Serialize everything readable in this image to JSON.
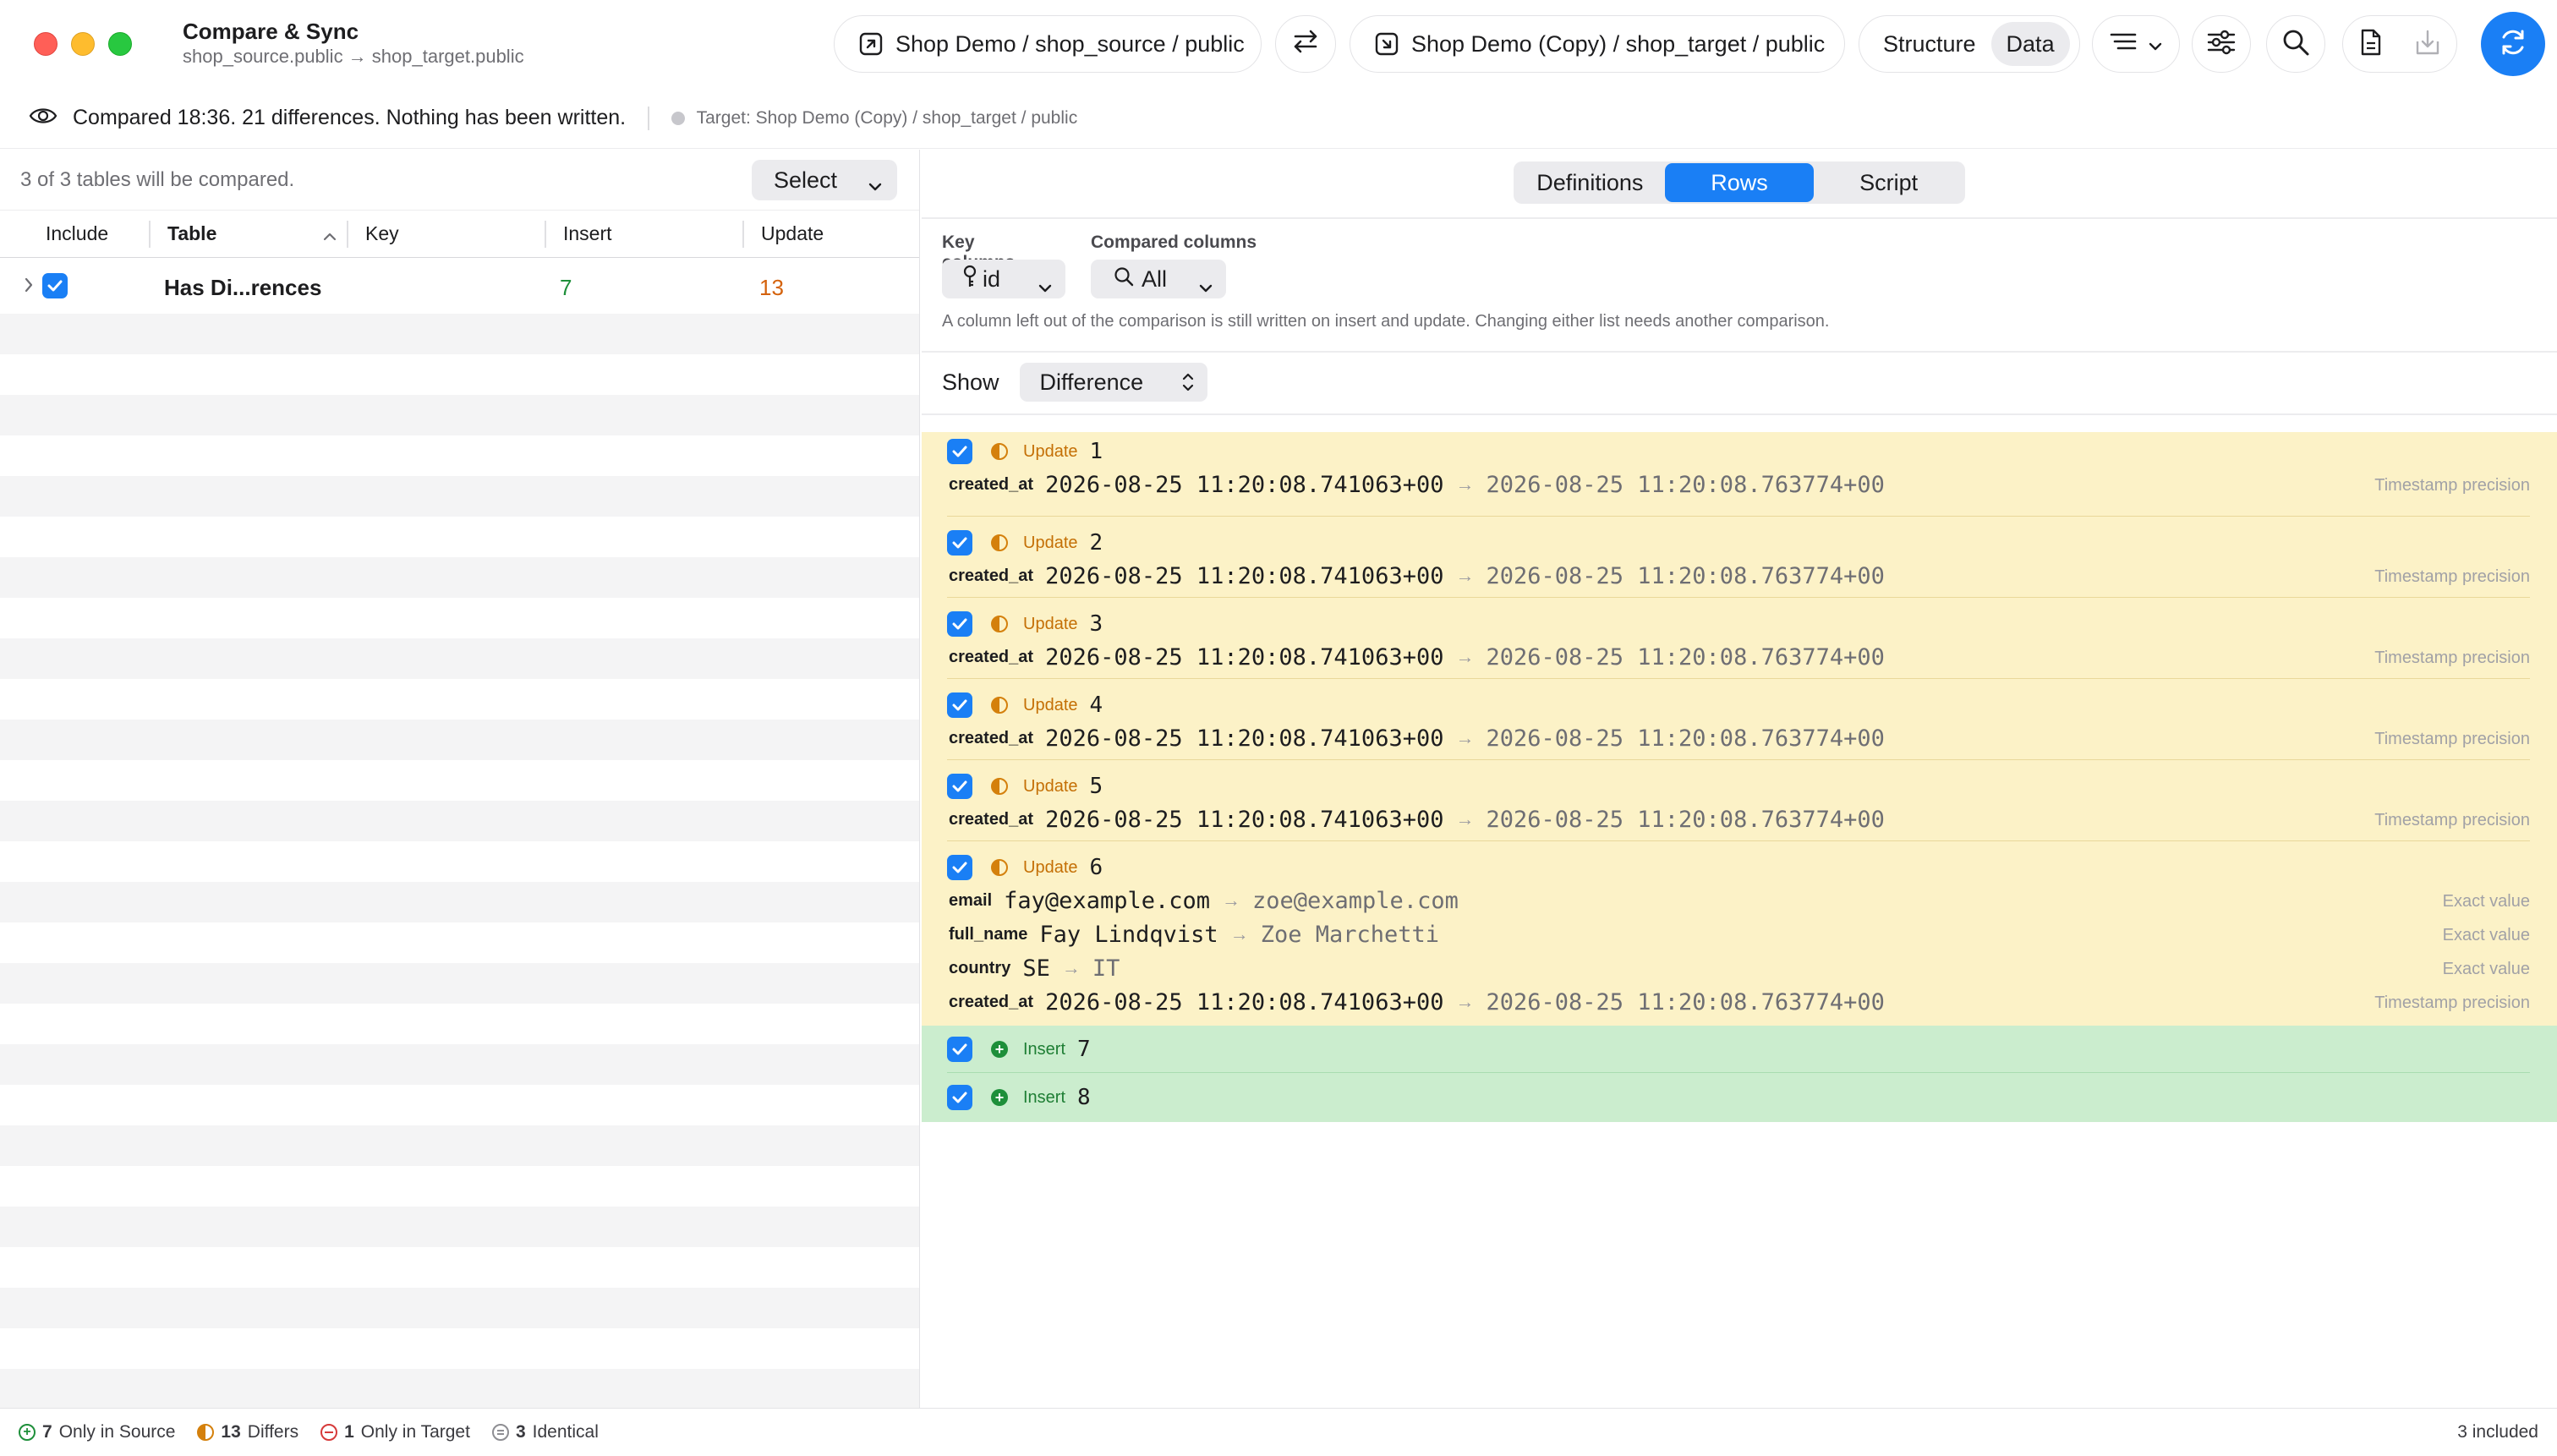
{
  "window": {
    "title": "Compare & Sync",
    "subtitle": "shop_source.public → shop_target.public"
  },
  "toolbar": {
    "source": "Shop Demo / shop_source / public",
    "target": "Shop Demo (Copy) / shop_target / public",
    "mode_structure": "Structure",
    "mode_data": "Data",
    "active_mode": "Data",
    "icons": [
      "open-in-icon",
      "swap-icon",
      "save-into-icon",
      "list-icon",
      "chevron-down-icon",
      "sliders-icon",
      "search-icon",
      "document-icon",
      "download-icon",
      "refresh-icon"
    ]
  },
  "status": {
    "message": "Compared 18:36. 21 differences. Nothing has been written.",
    "target": "Target: Shop Demo (Copy) / shop_target / public"
  },
  "left": {
    "count": "3 of 3 tables will be compared.",
    "select_label": "Select",
    "columns": {
      "include": "Include",
      "table": "Table",
      "key": "Key",
      "insert": "Insert",
      "update": "Update"
    },
    "rows": [
      {
        "table": "Has Di...rences",
        "key": "",
        "insert": "7",
        "update": "13",
        "checked": true
      }
    ]
  },
  "right": {
    "tabs": [
      "Definitions",
      "Rows",
      "Script"
    ],
    "active_tab": "Rows",
    "key_columns_label": "Key columns",
    "key_columns_value": "id",
    "compared_columns_label": "Compared columns",
    "compared_columns_value": "All",
    "hint": "A column left out of the comparison is still written on insert and update. Changing either list needs another comparison.",
    "show_label": "Show",
    "show_value": "Difference",
    "updates": [
      {
        "kind": "Update",
        "id": "1",
        "fields": [
          {
            "name": "created_at",
            "old": "2026-08-25 11:20:08.741063+00",
            "new": "2026-08-25 11:20:08.763774+00",
            "mode": "Timestamp precision"
          }
        ]
      },
      {
        "kind": "Update",
        "id": "2",
        "fields": [
          {
            "name": "created_at",
            "old": "2026-08-25 11:20:08.741063+00",
            "new": "2026-08-25 11:20:08.763774+00",
            "mode": "Timestamp precision"
          }
        ]
      },
      {
        "kind": "Update",
        "id": "3",
        "fields": [
          {
            "name": "created_at",
            "old": "2026-08-25 11:20:08.741063+00",
            "new": "2026-08-25 11:20:08.763774+00",
            "mode": "Timestamp precision"
          }
        ]
      },
      {
        "kind": "Update",
        "id": "4",
        "fields": [
          {
            "name": "created_at",
            "old": "2026-08-25 11:20:08.741063+00",
            "new": "2026-08-25 11:20:08.763774+00",
            "mode": "Timestamp precision"
          }
        ]
      },
      {
        "kind": "Update",
        "id": "5",
        "fields": [
          {
            "name": "created_at",
            "old": "2026-08-25 11:20:08.741063+00",
            "new": "2026-08-25 11:20:08.763774+00",
            "mode": "Timestamp precision"
          }
        ]
      },
      {
        "kind": "Update",
        "id": "6",
        "fields": [
          {
            "name": "email",
            "old": "fay@example.com",
            "new": "zoe@example.com",
            "mode": "Exact value"
          },
          {
            "name": "full_name",
            "old": "Fay Lindqvist",
            "new": "Zoe Marchetti",
            "mode": "Exact value"
          },
          {
            "name": "country",
            "old": "SE",
            "new": "IT",
            "mode": "Exact value"
          },
          {
            "name": "created_at",
            "old": "2026-08-25 11:20:08.741063+00",
            "new": "2026-08-25 11:20:08.763774+00",
            "mode": "Timestamp precision"
          }
        ]
      }
    ],
    "inserts": [
      {
        "kind": "Insert",
        "id": "7"
      },
      {
        "kind": "Insert",
        "id": "8"
      }
    ]
  },
  "footer": {
    "only_source_count": "7",
    "only_source_label": "Only in Source",
    "differs_count": "13",
    "differs_label": "Differs",
    "only_target_count": "1",
    "only_target_label": "Only in Target",
    "identical_count": "3",
    "identical_label": "Identical",
    "included": "3 included"
  },
  "colors": {
    "accent": "#1a7ff5",
    "update_bg": "#fcf2c7",
    "insert_bg": "#cbedce",
    "update_text": "#c46f05",
    "insert_text": "#1e7e34",
    "insert_count": "#1e8f3a",
    "update_count": "#d4620c"
  }
}
